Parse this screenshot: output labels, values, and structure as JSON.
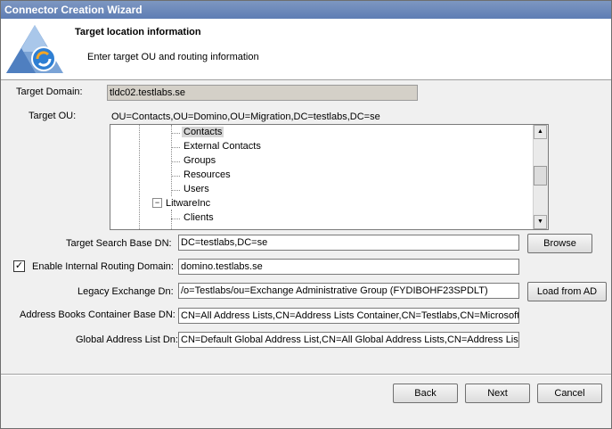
{
  "window": {
    "title": "Connector Creation Wizard"
  },
  "header": {
    "title": "Target location information",
    "subtitle": "Enter target OU and routing information"
  },
  "target_domain": {
    "label": "Target Domain:",
    "value": "tldc02.testlabs.se"
  },
  "target_ou": {
    "label": "Target OU:",
    "value": "OU=Contacts,OU=Domino,OU=Migration,DC=testlabs,DC=se"
  },
  "tree": {
    "items": [
      "Contacts",
      "External Contacts",
      "Groups",
      "Resources",
      "Users",
      "LitwareInc",
      "Clients"
    ],
    "expander": "−"
  },
  "search_base": {
    "label": "Target Search Base DN:",
    "value": "DC=testlabs,DC=se",
    "button": "Browse"
  },
  "routing": {
    "label": "Enable Internal Routing Domain:",
    "value": "domino.testlabs.se",
    "checked": "✓"
  },
  "legacy": {
    "label": "Legacy Exchange Dn:",
    "value": "/o=Testlabs/ou=Exchange Administrative Group (FYDIBOHF23SPDLT)",
    "button": "Load from AD"
  },
  "address_books": {
    "label": "Address Books Container Base DN:",
    "value": "CN=All Address Lists,CN=Address Lists Container,CN=Testlabs,CN=Microsoft Exc"
  },
  "gal": {
    "label": "Global Address List Dn:",
    "value": "CN=Default Global Address List,CN=All Global Address Lists,CN=Address Lists Co"
  },
  "footer": {
    "back": "Back",
    "next": "Next",
    "cancel": "Cancel"
  },
  "scroll": {
    "up": "▲",
    "down": "▼"
  },
  "colors": {
    "titlebar": "#5e7db4",
    "readonly_field": "#d4d0c8",
    "selection": "#d6d6d6"
  }
}
